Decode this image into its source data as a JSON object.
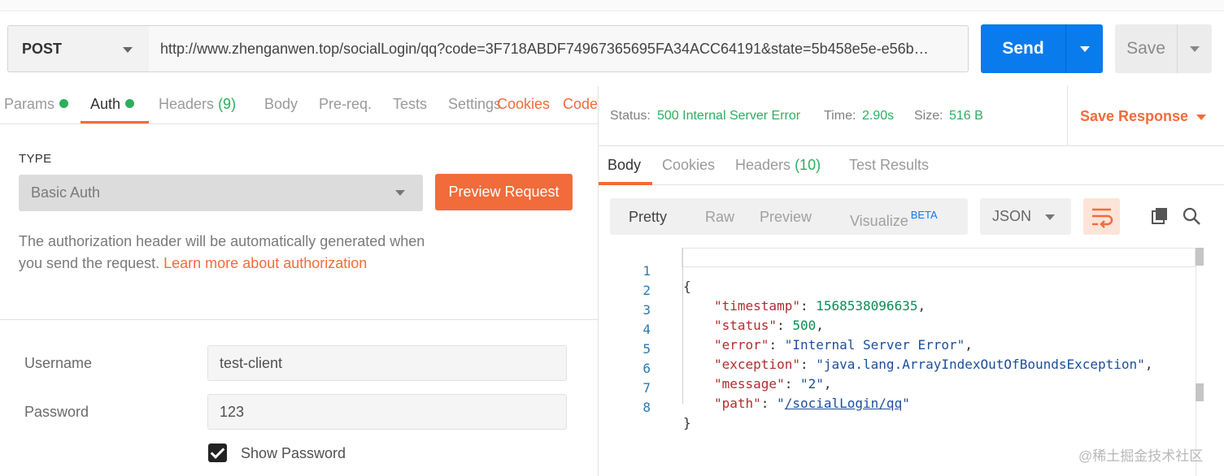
{
  "request": {
    "method": "POST",
    "url": "http://www.zhenganwen.top/socialLogin/qq?code=3F718ABDF74967365695FA34ACC64191&state=5b458e5e-e56b…",
    "send_label": "Send",
    "save_label": "Save"
  },
  "request_tabs": {
    "params": "Params",
    "auth": "Auth",
    "headers": "Headers",
    "headers_count": "(9)",
    "body": "Body",
    "prereq": "Pre-req.",
    "tests": "Tests",
    "settings": "Settings",
    "cookies": "Cookies",
    "code": "Code"
  },
  "auth": {
    "type_label": "TYPE",
    "type_value": "Basic Auth",
    "preview_button": "Preview Request",
    "description": "The authorization header will be automatically generated when you send the request.",
    "learn_more": "Learn more about authorization",
    "username_label": "Username",
    "username_value": "test-client",
    "password_label": "Password",
    "password_value": "123",
    "show_password_label": "Show Password"
  },
  "response": {
    "status_label": "Status:",
    "status_value": "500 Internal Server Error",
    "time_label": "Time:",
    "time_value": "2.90s",
    "size_label": "Size:",
    "size_value": "516 B",
    "save_response": "Save Response"
  },
  "response_tabs": {
    "body": "Body",
    "cookies": "Cookies",
    "headers": "Headers",
    "headers_count": "(10)",
    "test_results": "Test Results"
  },
  "format": {
    "pretty": "Pretty",
    "raw": "Raw",
    "preview": "Preview",
    "visualize": "Visualize",
    "beta": "BETA",
    "language": "JSON"
  },
  "code_lines": {
    "n1": "1",
    "n2": "2",
    "n3": "3",
    "n4": "4",
    "n5": "5",
    "n6": "6",
    "n7": "7",
    "n8": "8",
    "open_brace": "{",
    "close_brace": "}",
    "k_timestamp": "\"timestamp\"",
    "v_timestamp": "1568538096635",
    "k_status": "\"status\"",
    "v_status": "500",
    "k_error": "\"error\"",
    "v_error": "\"Internal Server Error\"",
    "k_exception": "\"exception\"",
    "v_exception": "\"java.lang.ArrayIndexOutOfBoundsException\"",
    "k_message": "\"message\"",
    "v_message": "\"2\"",
    "k_path": "\"path\"",
    "v_path": "/socialLogin/qq"
  },
  "watermark": "@稀土掘金技术社区",
  "colors": {
    "accent_orange": "#f26b3a",
    "send_blue": "#097bed",
    "status_green": "#2dae5f"
  }
}
